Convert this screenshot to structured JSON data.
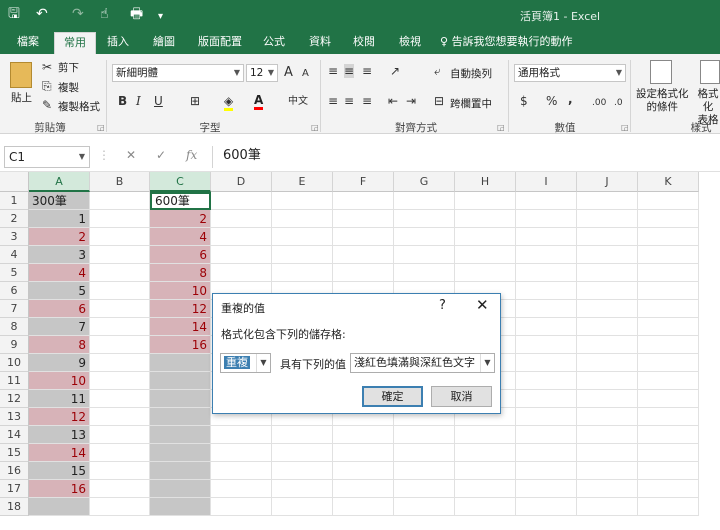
{
  "app": {
    "title": "活頁簿1 - Excel"
  },
  "quick_access": {
    "save": "🖫",
    "undo": "↶",
    "redo": "↷",
    "touch": "☝",
    "print": "🖶",
    "more": "▾"
  },
  "tabs": [
    "檔案",
    "常用",
    "插入",
    "繪圖",
    "版面配置",
    "公式",
    "資料",
    "校閱",
    "檢視"
  ],
  "tell_me": "告訴我您想要執行的動作",
  "ribbon": {
    "clipboard": {
      "paste": "貼上",
      "cut": "剪下",
      "copy": "複製",
      "format_painter": "複製格式",
      "group": "剪貼簿"
    },
    "font": {
      "name": "新細明體",
      "size": "12",
      "grow": "A",
      "shrink": "A",
      "bold": "B",
      "italic": "I",
      "underline": "U",
      "phonetic": "中文",
      "group": "字型"
    },
    "alignment": {
      "wrap": "自動換列",
      "merge": "跨欄置中",
      "group": "對齊方式"
    },
    "number": {
      "format": "通用格式",
      "currency": "$",
      "percent": "%",
      "comma": ",",
      "inc_decimal": ".00",
      "dec_decimal": ".0",
      "group": "數值"
    },
    "styles": {
      "conditional": "設定格式化\n的條件",
      "as_table": "格式化\n表格",
      "group": "樣式"
    }
  },
  "formula_bar": {
    "name_box": "C1",
    "cancel": "✕",
    "enter": "✓",
    "fx": "fx",
    "value": "600筆"
  },
  "columns": [
    "A",
    "B",
    "C",
    "D",
    "E",
    "F",
    "G",
    "H",
    "I",
    "J",
    "K"
  ],
  "rows": [
    "1",
    "2",
    "3",
    "4",
    "5",
    "6",
    "7",
    "8",
    "9",
    "10",
    "11",
    "12",
    "13",
    "14",
    "15",
    "16",
    "17",
    "18"
  ],
  "col_a": [
    "300筆",
    "1",
    "2",
    "3",
    "4",
    "5",
    "6",
    "7",
    "8",
    "9",
    "10",
    "11",
    "12",
    "13",
    "14",
    "15",
    "16",
    ""
  ],
  "col_a_style": [
    "gray",
    "gray",
    "red",
    "gray",
    "red",
    "gray",
    "red",
    "gray",
    "red",
    "gray",
    "red",
    "gray",
    "red",
    "gray",
    "red",
    "gray",
    "red",
    "gray"
  ],
  "col_c": [
    "600筆",
    "2",
    "4",
    "6",
    "8",
    "10",
    "12",
    "14",
    "16",
    "",
    "",
    "",
    "",
    "",
    "",
    "",
    "",
    ""
  ],
  "col_c_style": [
    "white",
    "red",
    "red",
    "red",
    "red",
    "red",
    "red",
    "red",
    "red",
    "gray",
    "gray",
    "gray",
    "gray",
    "gray",
    "gray",
    "gray",
    "gray",
    "gray"
  ],
  "dialog": {
    "title": "重複的值",
    "help": "?",
    "close": "✕",
    "prompt": "格式化包含下列的儲存格:",
    "type_value": "重複",
    "with_label": "具有下列的值",
    "format_value": "淺紅色填滿與深紅色文字",
    "ok": "確定",
    "cancel": "取消"
  },
  "colors": {
    "excel_green": "#217346",
    "dup_fill": "#d7b3b8",
    "dup_text": "#9c0006",
    "gray_fill": "#c6c6c6"
  }
}
